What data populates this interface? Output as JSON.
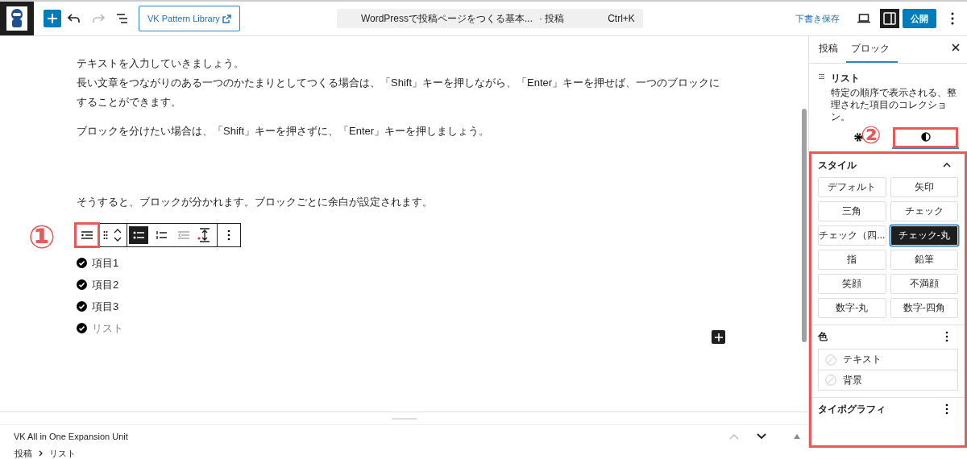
{
  "topbar": {
    "pattern_library": "VK Pattern Library",
    "undo_disabled": false,
    "redo_disabled": true,
    "command_bar": {
      "title": "WordPressで投稿ページをつくる基本...",
      "type": "· 投稿",
      "shortcut": "Ctrl+K"
    },
    "save_draft": "下書き保存",
    "settings_selected": true,
    "publish": "公開"
  },
  "content": {
    "paragraphs": [
      {
        "lines": [
          "テキストを入力していきましょう。",
          "長い文章をつながりのある一つのかたまりとしてつくる場合は、「Shift」キーを押しながら、「Enter」キーを押せば、一つのブロックにすることができます。"
        ]
      },
      {
        "lines": [
          "ブロックを分けたい場合は、「Shift」キーを押さずに、「Enter」キーを押しましょう。"
        ]
      },
      {
        "lines": [
          "そうすると、ブロックが分かれます。ブロックごとに余白が設定されます。"
        ]
      }
    ],
    "block_toolbar": [
      {
        "kind": "list",
        "selected": false,
        "disabled": false
      },
      {
        "kind": "drag",
        "selected": false,
        "disabled": false
      },
      {
        "kind": "move",
        "selected": false,
        "disabled": false
      },
      {
        "kind": "unordered",
        "selected": true,
        "disabled": false
      },
      {
        "kind": "ordered",
        "selected": false,
        "disabled": false
      },
      {
        "kind": "outdent",
        "selected": false,
        "disabled": true
      },
      {
        "kind": "spacing",
        "selected": false,
        "disabled": false
      },
      {
        "kind": "more",
        "selected": false,
        "disabled": false
      }
    ],
    "list_items": [
      {
        "text": "項目1",
        "kind": "item"
      },
      {
        "text": "項目2",
        "kind": "item"
      },
      {
        "text": "項目3",
        "kind": "item"
      },
      {
        "text": "リスト",
        "kind": "placeholder"
      }
    ]
  },
  "annotations": [
    {
      "label": "①"
    },
    {
      "label": "②"
    }
  ],
  "sidebar": {
    "tabs": [
      {
        "label": "投稿",
        "selected": false
      },
      {
        "label": "ブロック",
        "selected": true
      }
    ],
    "block_card": {
      "name": "リスト",
      "description": "特定の順序で表示される、整理された項目のコレクション。"
    },
    "sub_tabs": [
      {
        "kind": "settings",
        "selected": false
      },
      {
        "kind": "styles",
        "selected": true
      }
    ],
    "style_panel": {
      "title": "スタイル",
      "expanded": true,
      "options": [
        {
          "label": "デフォルト",
          "selected": false
        },
        {
          "label": "矢印",
          "selected": false
        },
        {
          "label": "三角",
          "selected": false
        },
        {
          "label": "チェック",
          "selected": false
        },
        {
          "label": "チェック（四...",
          "selected": false
        },
        {
          "label": "チェック-丸",
          "selected": true
        },
        {
          "label": "指",
          "selected": false
        },
        {
          "label": "鉛筆",
          "selected": false
        },
        {
          "label": "笑顔",
          "selected": false
        },
        {
          "label": "不満顔",
          "selected": false
        },
        {
          "label": "数字-丸",
          "selected": false
        },
        {
          "label": "数字-四角",
          "selected": false
        }
      ]
    },
    "color_panel": {
      "title": "色",
      "items": [
        "テキスト",
        "背景"
      ]
    },
    "typography_panel": {
      "title": "タイポグラフィ"
    }
  },
  "metabox": {
    "title": "VK All in One Expansion Unit"
  },
  "breadcrumb": [
    "投稿",
    "リスト"
  ]
}
